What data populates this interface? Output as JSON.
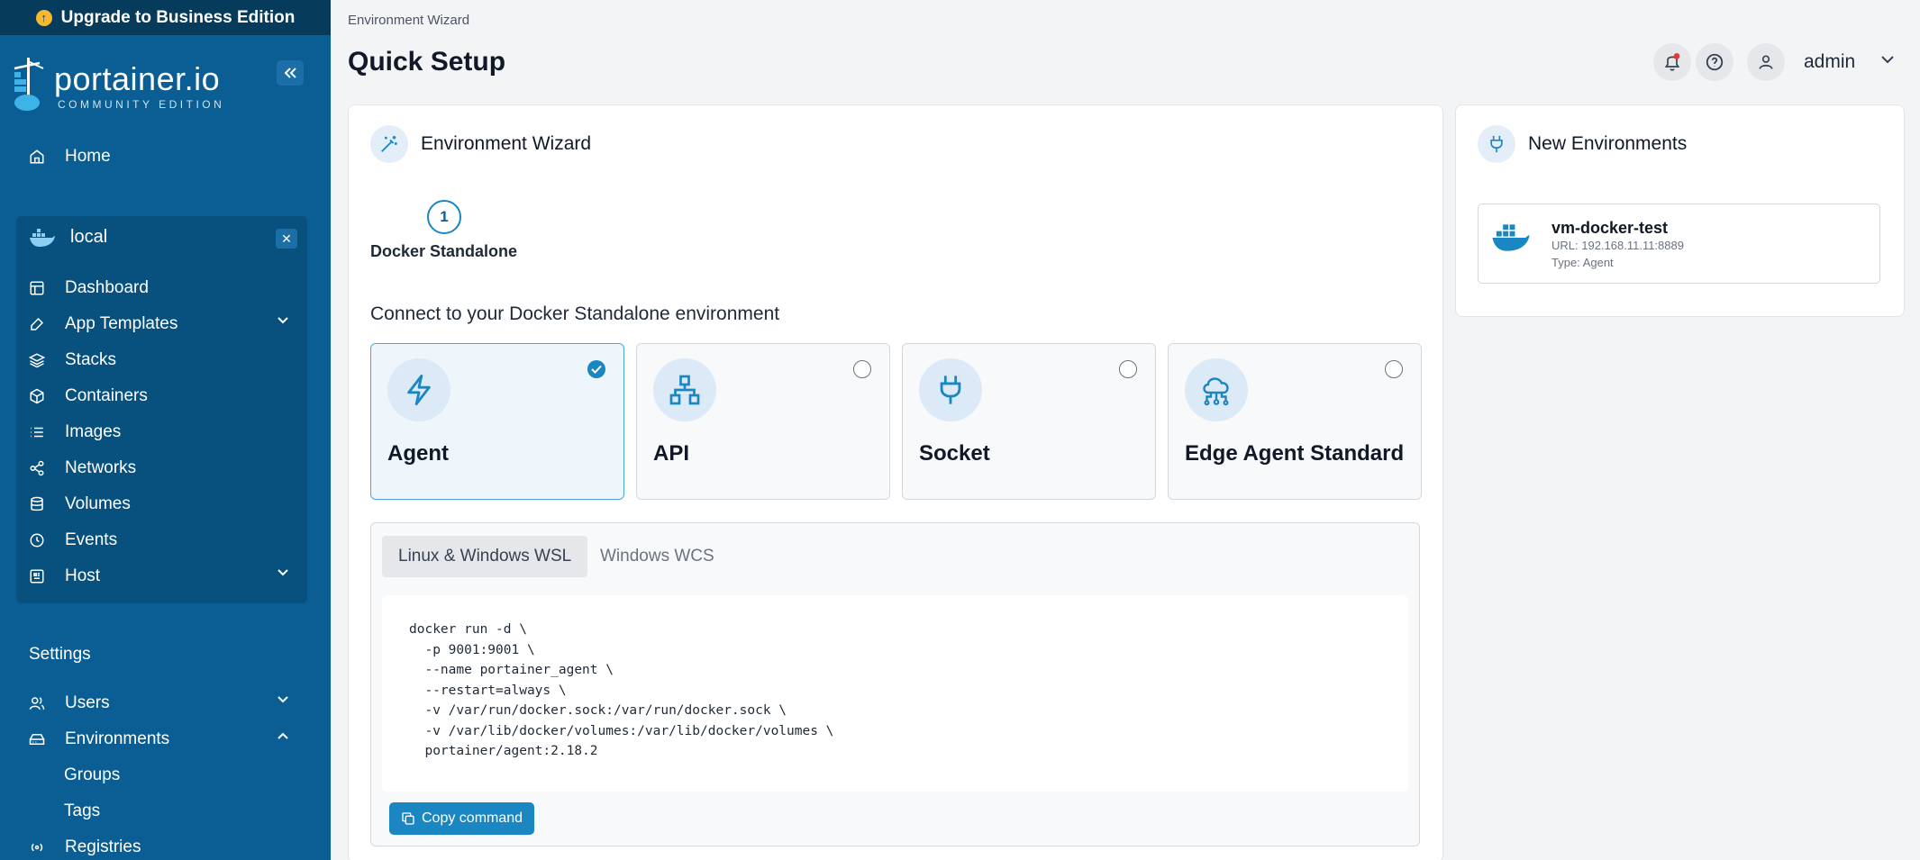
{
  "upgrade": {
    "label": "Upgrade to Business Edition"
  },
  "brand": {
    "name": "portainer.io",
    "edition": "COMMUNITY EDITION"
  },
  "sidebar": {
    "home": "Home",
    "environment": {
      "name": "local"
    },
    "env_items": [
      {
        "label": "Dashboard",
        "icon": "dashboard-icon"
      },
      {
        "label": "App Templates",
        "icon": "edit-icon"
      },
      {
        "label": "Stacks",
        "icon": "layers-icon"
      },
      {
        "label": "Containers",
        "icon": "box-icon"
      },
      {
        "label": "Images",
        "icon": "list-icon"
      },
      {
        "label": "Networks",
        "icon": "share-icon"
      },
      {
        "label": "Volumes",
        "icon": "database-icon"
      },
      {
        "label": "Events",
        "icon": "clock-icon"
      },
      {
        "label": "Host",
        "icon": "server-icon"
      }
    ],
    "settings_label": "Settings",
    "settings_items": [
      {
        "label": "Users",
        "icon": "users-icon"
      },
      {
        "label": "Environments",
        "icon": "hdd-icon"
      },
      {
        "label": "Groups"
      },
      {
        "label": "Tags"
      },
      {
        "label": "Registries",
        "icon": "radio-icon"
      }
    ]
  },
  "header": {
    "breadcrumb": "Environment Wizard",
    "title": "Quick Setup",
    "user": "admin"
  },
  "wizard": {
    "title": "Environment Wizard",
    "step_number": "1",
    "step_label": "Docker Standalone",
    "connect_label": "Connect to your Docker Standalone environment",
    "options": [
      {
        "label": "Agent",
        "icon": "zap-icon",
        "selected": true
      },
      {
        "label": "API",
        "icon": "network-icon",
        "selected": false
      },
      {
        "label": "Socket",
        "icon": "plug-icon",
        "selected": false
      },
      {
        "label": "Edge Agent Standard",
        "icon": "cloud-icon",
        "selected": false
      }
    ],
    "tabs": [
      "Linux & Windows WSL",
      "Windows WCS"
    ],
    "command_lines": [
      "docker run -d \\",
      "  -p 9001:9001 \\",
      "  --name portainer_agent \\",
      "  --restart=always \\",
      "  -v /var/run/docker.sock:/var/run/docker.sock \\",
      "  -v /var/lib/docker/volumes:/var/lib/docker/volumes \\",
      "  portainer/agent:2.18.2"
    ],
    "copy_label": "Copy command"
  },
  "new_environments": {
    "title": "New Environments",
    "items": [
      {
        "name": "vm-docker-test",
        "url": "URL: 192.168.11.11:8889",
        "type": "Type: Agent"
      }
    ]
  },
  "colors": {
    "sidebar": "#0b5e93",
    "accent": "#1a86c2",
    "upgrade_bar": "#063b5c"
  }
}
